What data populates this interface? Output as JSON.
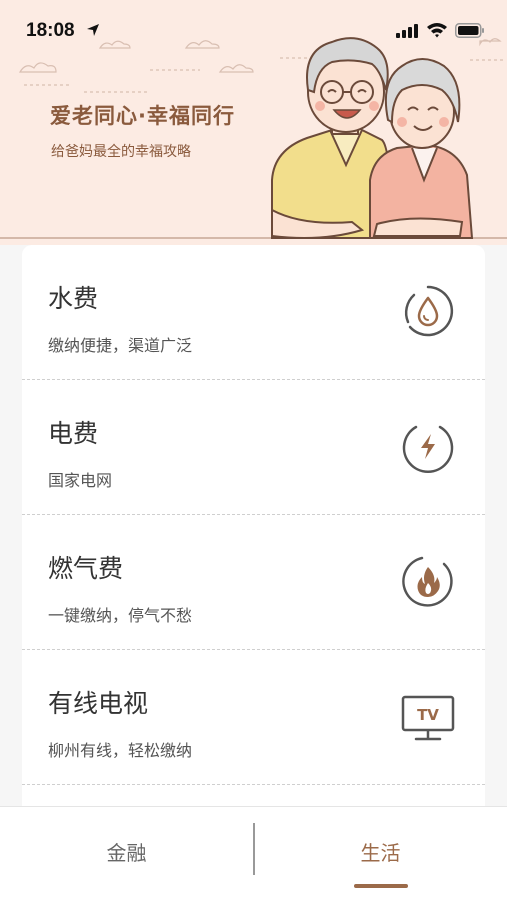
{
  "status_bar": {
    "time": "18:08"
  },
  "banner": {
    "title": "爱老同心·幸福同行",
    "subtitle": "给爸妈最全的幸福攻略"
  },
  "services": [
    {
      "title": "水费",
      "subtitle": "缴纳便捷，渠道广泛",
      "icon": "water-drop-icon"
    },
    {
      "title": "电费",
      "subtitle": "国家电网",
      "icon": "lightning-icon"
    },
    {
      "title": "燃气费",
      "subtitle": "一键缴纳，停气不愁",
      "icon": "flame-icon"
    },
    {
      "title": "有线电视",
      "subtitle": "柳州有线，轻松缴纳",
      "icon": "tv-icon",
      "icon_text": "TV"
    }
  ],
  "tabs": [
    {
      "label": "金融",
      "active": false
    },
    {
      "label": "生活",
      "active": true
    }
  ],
  "colors": {
    "accent": "#9b6a49",
    "banner_bg": "#fcebe3"
  }
}
